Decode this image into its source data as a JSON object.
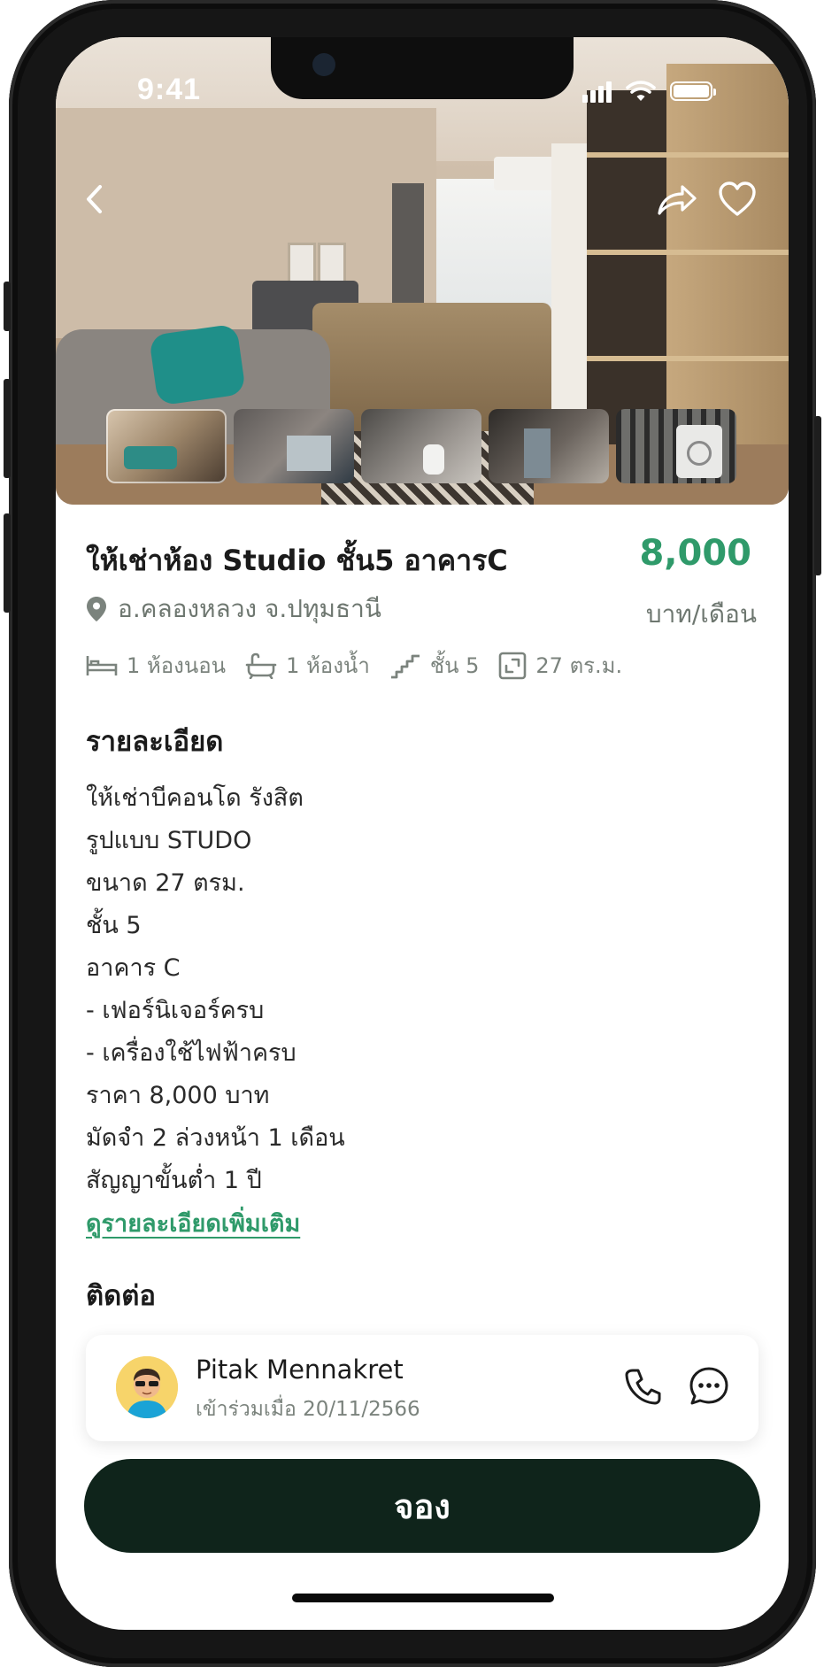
{
  "status_bar": {
    "time": "9:41"
  },
  "listing": {
    "title": "ให้เช่าห้อง Studio ชั้น5 อาคารC",
    "price": "8,000",
    "price_unit": "บาท/เดือน",
    "location": "อ.คลองหลวง จ.ปทุมธานี",
    "specs": [
      {
        "icon": "bed-icon",
        "label": "1 ห้องนอน"
      },
      {
        "icon": "bathtub-icon",
        "label": "1 ห้องน้ำ"
      },
      {
        "icon": "stairs-icon",
        "label": "ชั้น 5"
      },
      {
        "icon": "area-icon",
        "label": "27 ตร.ม."
      }
    ]
  },
  "details": {
    "heading": "รายละเอียด",
    "lines": [
      "ให้เช่าบีคอนโด รังสิต",
      "รูปแบบ STUDO",
      "ขนาด 27 ตรม.",
      "ชั้น 5",
      "อาคาร C",
      "- เฟอร์นิเจอร์ครบ",
      "- เครื่องใช้ไฟฟ้าครบ",
      "ราคา 8,000 บาท",
      "มัดจำ 2 ล่วงหน้า 1 เดือน",
      "สัญญาขั้นต่ำ 1 ปี"
    ],
    "more_link": "ดูรายละเอียดเพิ่มเติม"
  },
  "contact": {
    "heading": "ติดต่อ",
    "name": "Pitak Mennakret",
    "joined": "เข้าร่วมเมื่อ 20/11/2566"
  },
  "actions": {
    "book_label": "จอง"
  },
  "colors": {
    "accent": "#2f9a6a",
    "button": "#0f241b"
  },
  "icons": [
    "back-arrow-icon",
    "share-icon",
    "heart-icon",
    "location-pin-icon",
    "phone-icon",
    "chat-icon"
  ]
}
